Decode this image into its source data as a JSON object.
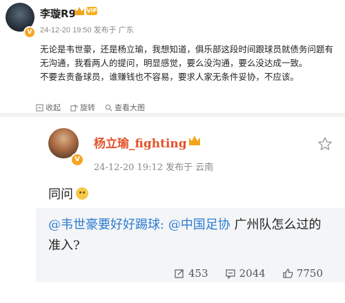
{
  "post": {
    "author": "李璇R9",
    "vip_badge": "VIP",
    "badge": "V",
    "meta": "24-12-20 19:50 发布于 广东",
    "paragraph1": "无论是韦世豪，还是杨立瑜，我想知道，俱乐部这段时间跟球员就债务问题有无沟通，我看两人的提问，明显感觉，要么没沟通，要么没达成一致。",
    "paragraph2": "不要去责备球员，谁赚钱也不容易，要求人家无条件妥协，不应该。",
    "actions": {
      "collect": "收起",
      "rotate": "旋转",
      "view_large": "查看大图"
    }
  },
  "embedded": {
    "author": "杨立瑜_fighting",
    "badge": "V",
    "meta": "24-12-20 19:12 发布于 云南",
    "content": "同问",
    "repost": {
      "mention1": "@韦世豪要好好踢球:",
      "mention2": "@中国足协",
      "text": " 广州队怎么过的准入?"
    },
    "footer": {
      "reposts": "453",
      "comments": "2044",
      "likes": "7750"
    }
  },
  "icons": [
    "crown-icon",
    "vip-icon",
    "verified-icon",
    "collapse-icon",
    "rotate-icon",
    "zoom-icon",
    "star-icon",
    "repost-icon",
    "comment-icon",
    "like-icon"
  ],
  "colors": {
    "embed_name": "#e4522b",
    "mention": "#2b7bd1",
    "badge": "#f5a623"
  }
}
